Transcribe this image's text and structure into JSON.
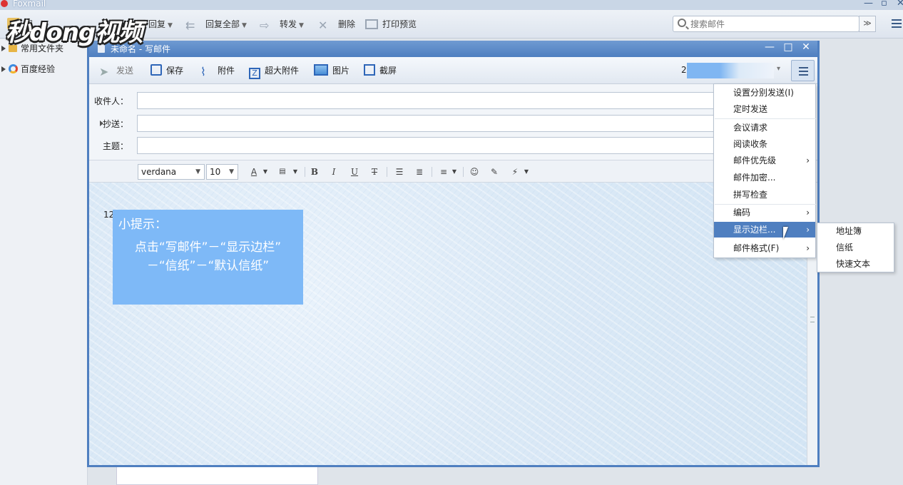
{
  "app": {
    "title": "Foxmail",
    "toolbar": {
      "write": "写",
      "reply": "回复",
      "reply_all": "回复全部",
      "forward": "转发",
      "delete": "删除",
      "print_preview": "打印预览"
    },
    "search_placeholder": "搜索邮件"
  },
  "sidebar": {
    "items": [
      {
        "label": "常用文件夹"
      },
      {
        "label": "百度经验"
      }
    ]
  },
  "watermark": {
    "text": "秒dong视频"
  },
  "compose": {
    "title": "未命名 - 写邮件",
    "toolbar": {
      "send": "发送",
      "save": "保存",
      "attach": "附件",
      "big_attach": "超大附件",
      "image": "图片",
      "screenshot": "截屏"
    },
    "account_prefix": "2",
    "fields": {
      "to_label": "收件人：",
      "cc_label": "抄送：",
      "subject_label": "主题："
    },
    "format": {
      "font": "verdana",
      "size": "10"
    },
    "body_text": "12"
  },
  "tip": {
    "title": "小提示：",
    "line1": "点击“写邮件”－“显示边栏”",
    "line2": "－“信纸”－“默认信纸”"
  },
  "menu": {
    "items": [
      {
        "label": "设置分别发送(I)",
        "has_sub": false
      },
      {
        "label": "定时发送",
        "has_sub": false
      },
      {
        "label": "会议请求",
        "has_sub": false
      },
      {
        "label": "阅读收条",
        "has_sub": false
      },
      {
        "label": "邮件优先级",
        "has_sub": true
      },
      {
        "label": "邮件加密...",
        "has_sub": false
      },
      {
        "label": "拼写检查",
        "has_sub": false
      },
      {
        "label": "编码",
        "has_sub": true
      },
      {
        "label": "显示边栏...",
        "has_sub": true,
        "active": true
      },
      {
        "label": "邮件格式(F)",
        "has_sub": true
      }
    ],
    "submenu": [
      {
        "label": "地址簿"
      },
      {
        "label": "信纸"
      },
      {
        "label": "快速文本"
      }
    ]
  },
  "colors": {
    "accent": "#4f7fc0",
    "tip_bg": "#7eb9f7",
    "menu_active": "#4f7fc0"
  }
}
